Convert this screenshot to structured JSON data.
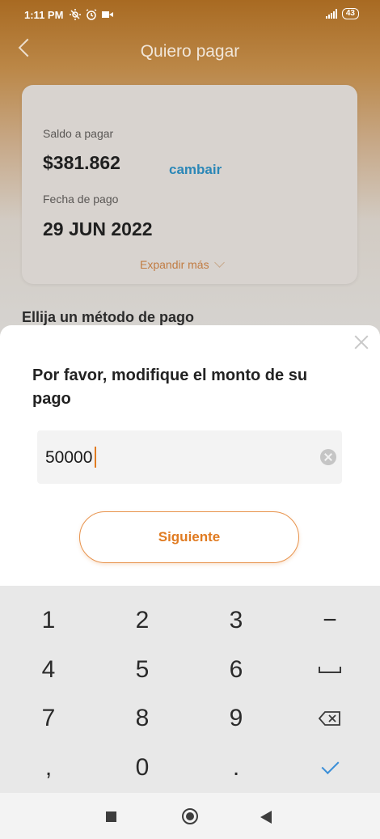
{
  "status_bar": {
    "time": "1:11 PM",
    "battery": "43"
  },
  "header": {
    "title": "Quiero pagar",
    "back_icon": "chevron-left-icon"
  },
  "summary_card": {
    "balance_label": "Saldo a pagar",
    "balance_value": "$381.862",
    "change_link": "cambair",
    "date_label": "Fecha de pago",
    "date_value": "29 JUN 2022",
    "expand_label": "Expandir más"
  },
  "method_heading": "Ellija un método de pago",
  "dialog": {
    "prompt": "Por favor, modifique el monto de su pago",
    "amount_value": "50000",
    "next_button": "Siguiente",
    "accent_color": "#e07b21"
  },
  "keypad": {
    "keys": [
      "1",
      "2",
      "3",
      "−",
      "4",
      "5",
      "6",
      "space",
      "7",
      "8",
      "9",
      "delete",
      ",",
      "0",
      ".",
      "done"
    ]
  }
}
